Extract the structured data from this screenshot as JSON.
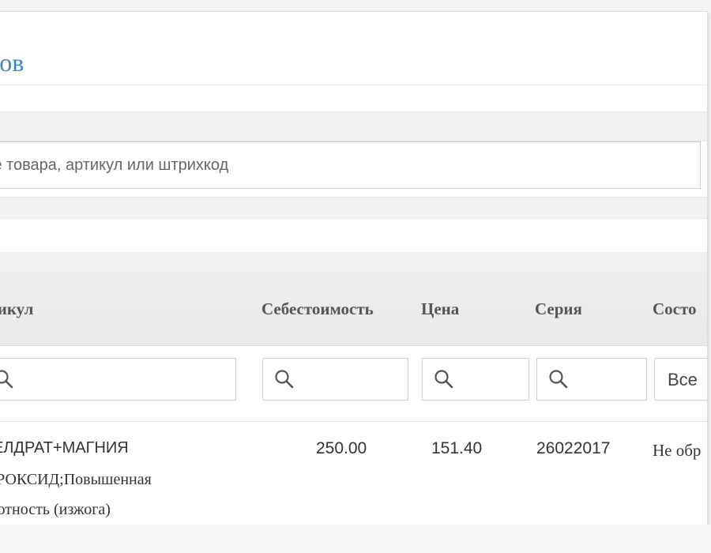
{
  "header": {
    "title": "аров"
  },
  "search": {
    "placeholder": "ание товара, артикул или штрихкод"
  },
  "table": {
    "columns": [
      {
        "key": "article",
        "label": "ртикул"
      },
      {
        "key": "cost",
        "label": "Себестоимость"
      },
      {
        "key": "price",
        "label": "Цена"
      },
      {
        "key": "series",
        "label": "Серия"
      },
      {
        "key": "state",
        "label": "Состо"
      }
    ],
    "filters": {
      "state_selected": "Все"
    },
    "rows": [
      {
        "name_line1": "ЛГЕЛДРАТ+МАГНИЯ",
        "name_line2": "ИДРОКСИД;Повышенная",
        "name_line3": "ислотность (изжога)",
        "cost": "250.00",
        "price": "151.40",
        "series": "26022017",
        "state": "Не обр"
      }
    ]
  },
  "icons": {
    "filter_search": "magnifier-icon"
  }
}
